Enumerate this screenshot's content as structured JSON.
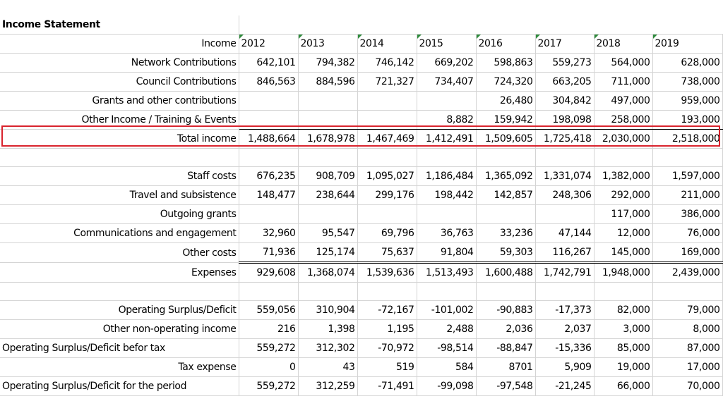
{
  "title": "Income Statement",
  "header": {
    "label": "Income",
    "years": [
      "2012",
      "2013",
      "2014",
      "2015",
      "2016",
      "2017",
      "2018",
      "2019"
    ]
  },
  "income_rows": [
    {
      "label": "Network Contributions",
      "values": [
        "642,101",
        "794,382",
        "746,142",
        "669,202",
        "598,863",
        "559,273",
        "564,000",
        "628,000"
      ]
    },
    {
      "label": "Council Contributions",
      "values": [
        "846,563",
        "884,596",
        "721,327",
        "734,407",
        "724,320",
        "663,205",
        "711,000",
        "738,000"
      ]
    },
    {
      "label": "Grants and other contributions",
      "values": [
        "",
        "",
        "",
        "",
        "26,480",
        "304,842",
        "497,000",
        "959,000"
      ]
    },
    {
      "label": "Other Income / Training & Events",
      "values": [
        "",
        "",
        "",
        "8,882",
        "159,942",
        "198,098",
        "258,000",
        "193,000"
      ]
    }
  ],
  "total_income": {
    "label": "Total income",
    "values": [
      "1,488,664",
      "1,678,978",
      "1,467,469",
      "1,412,491",
      "1,509,605",
      "1,725,418",
      "2,030,000",
      "2,518,000"
    ]
  },
  "expense_rows": [
    {
      "label": "Staff costs",
      "values": [
        "676,235",
        "908,709",
        "1,095,027",
        "1,186,484",
        "1,365,092",
        "1,331,074",
        "1,382,000",
        "1,597,000"
      ]
    },
    {
      "label": "Travel and subsistence",
      "values": [
        "148,477",
        "238,644",
        "299,176",
        "198,442",
        "142,857",
        "248,306",
        "292,000",
        "211,000"
      ]
    },
    {
      "label": "Outgoing grants",
      "values": [
        "",
        "",
        "",
        "",
        "",
        "",
        "117,000",
        "386,000"
      ]
    },
    {
      "label": "Communications and engagement",
      "values": [
        "32,960",
        "95,547",
        "69,796",
        "36,763",
        "33,236",
        "47,144",
        "12,000",
        "76,000"
      ]
    },
    {
      "label": "Other costs",
      "values": [
        "71,936",
        "125,174",
        "75,637",
        "91,804",
        "59,303",
        "116,267",
        "145,000",
        "169,000"
      ]
    }
  ],
  "expenses_total": {
    "label": "Expenses",
    "values": [
      "929,608",
      "1,368,074",
      "1,539,636",
      "1,513,493",
      "1,600,488",
      "1,742,791",
      "1,948,000",
      "2,439,000"
    ]
  },
  "surplus_rows": [
    {
      "label": "Operating Surplus/Deficit",
      "align": "right",
      "values": [
        "559,056",
        "310,904",
        "-72,167",
        "-101,002",
        "-90,883",
        "-17,373",
        "82,000",
        "79,000"
      ]
    },
    {
      "label": "Other non-operating income",
      "align": "right",
      "values": [
        "216",
        "1,398",
        "1,195",
        "2,488",
        "2,036",
        "2,037",
        "3,000",
        "8,000"
      ]
    },
    {
      "label": "Operating Surplus/Deficit befor tax",
      "align": "left",
      "values": [
        "559,272",
        "312,302",
        "-70,972",
        "-98,514",
        "-88,847",
        "-15,336",
        "85,000",
        "87,000"
      ]
    },
    {
      "label": "Tax expense",
      "align": "right",
      "values": [
        "0",
        "43",
        "519",
        "584",
        "8701",
        "5,909",
        "19,000",
        "17,000"
      ]
    },
    {
      "label": "Operating Surplus/Deficit for the period",
      "align": "left",
      "values": [
        "559,272",
        "312,259",
        "-71,491",
        "-99,098",
        "-97,548",
        "-21,245",
        "66,000",
        "70,000"
      ]
    }
  ],
  "colors": {
    "highlight_border": "#d9232d",
    "year_marker": "#2e8b3c",
    "gridline": "#d4d4d4"
  }
}
